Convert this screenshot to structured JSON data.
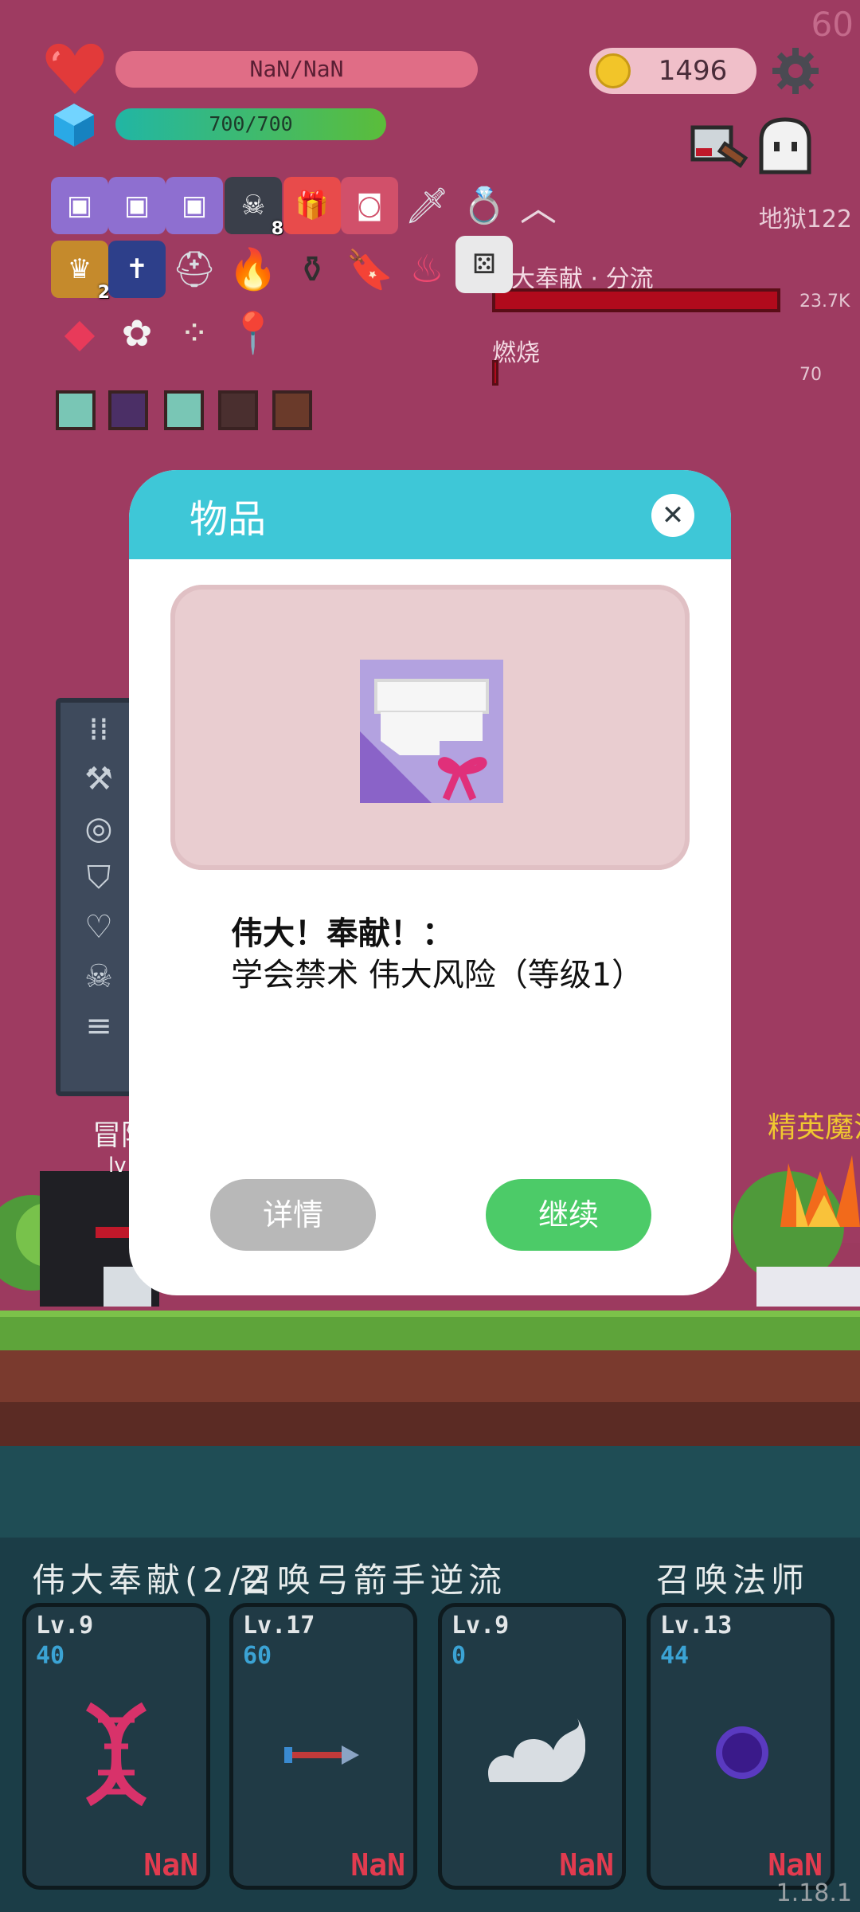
{
  "hud": {
    "hp_text": "NaN/NaN",
    "mp_text": "700/700",
    "gold": "1496",
    "floor": "地狱122",
    "fps": "60",
    "version": "1.18.1"
  },
  "status_icons": [
    {
      "icon": "scroll-ribbon-icon",
      "badge": ""
    },
    {
      "icon": "scroll-ribbon-icon",
      "badge": ""
    },
    {
      "icon": "scroll-ribbon-icon",
      "badge": ""
    },
    {
      "icon": "skull-tome-icon",
      "badge": "8"
    },
    {
      "icon": "gift-icon",
      "badge": ""
    },
    {
      "icon": "jam-jar-icon",
      "badge": ""
    },
    {
      "icon": "sword-icon",
      "badge": ""
    },
    {
      "icon": "ring-icon",
      "badge": ""
    },
    {
      "icon": "book-crown-icon",
      "badge": "2"
    },
    {
      "icon": "holy-book-icon",
      "badge": ""
    },
    {
      "icon": "viking-helmet-icon",
      "badge": ""
    },
    {
      "icon": "flame-icon",
      "badge": ""
    },
    {
      "icon": "cauldron-icon",
      "badge": ""
    },
    {
      "icon": "bookmark-icon",
      "badge": ""
    },
    {
      "icon": "pink-flame-icon",
      "badge": ""
    },
    {
      "icon": "dice-icon",
      "badge": ""
    },
    {
      "icon": "ruby-icon",
      "badge": ""
    },
    {
      "icon": "flower-icon",
      "badge": ""
    },
    {
      "icon": "cluster-icon",
      "badge": ""
    },
    {
      "icon": "map-pin-icon",
      "badge": ""
    }
  ],
  "enemy": {
    "buff1_name": "伟大奉献 · 分流",
    "buff1_value": "23.7K",
    "buff2_name": "燃烧",
    "buff2_value": "70"
  },
  "battle": {
    "hero_label_partial": "冒险",
    "hero_level_partial": "lv",
    "enemy_label_partial": "精英魔法"
  },
  "skills": {
    "title1": "伟大奉献(2/2",
    "title2": "召唤弓箭手逆流",
    "title3": "召唤法师",
    "cards": [
      {
        "level": "Lv.9",
        "count": "40",
        "icon": "dna-icon",
        "cost": "NaN"
      },
      {
        "level": "Lv.17",
        "count": "60",
        "icon": "arrow-icon",
        "cost": "NaN"
      },
      {
        "level": "Lv.9",
        "count": "0",
        "icon": "cloud-icon",
        "cost": "NaN"
      },
      {
        "level": "Lv.13",
        "count": "44",
        "icon": "dark-orb-icon",
        "cost": "NaN"
      }
    ]
  },
  "modal": {
    "title": "物品",
    "item_name": "伟大！奉献！：",
    "item_desc": "学会禁术 伟大风险（等级1）",
    "details_button": "详情",
    "continue_button": "继续",
    "close_glyph": "✕"
  },
  "colors": {
    "sky": "#9e3b61",
    "modal_header": "#3ec7d7",
    "continue": "#4ccb68",
    "details": "#b8b8b8",
    "cost_red": "#e23b4f"
  }
}
